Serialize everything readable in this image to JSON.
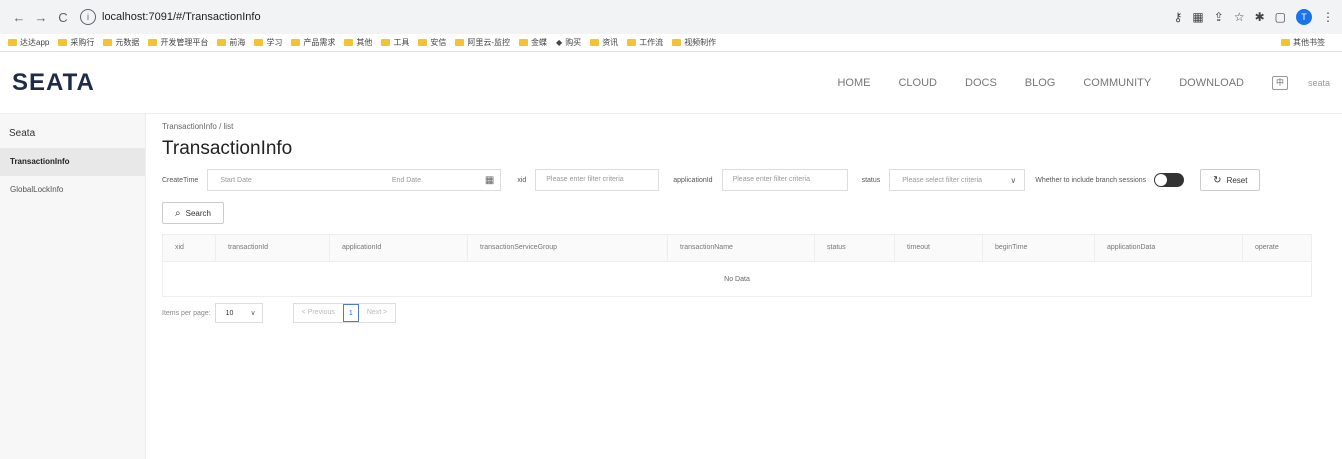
{
  "browser": {
    "url": "localhost:7091/#/TransactionInfo",
    "bookmarks": [
      "达达app",
      "采购行",
      "元数据",
      "开发管理平台",
      "前海",
      "学习",
      "产品需求",
      "其他",
      "工具",
      "安信",
      "阿里云-监控",
      "金蝶",
      "购买",
      "资讯",
      "工作流",
      "视频制作"
    ],
    "other_bookmarks": "其他书签",
    "avatar_letter": "T"
  },
  "header": {
    "logo": "SEATA",
    "nav": [
      "HOME",
      "CLOUD",
      "DOCS",
      "BLOG",
      "COMMUNITY",
      "DOWNLOAD"
    ],
    "lang_label": "中",
    "user": "seata"
  },
  "sidebar": {
    "title": "Seata",
    "items": [
      {
        "label": "TransactionInfo",
        "active": true
      },
      {
        "label": "GlobalLockInfo",
        "active": false
      }
    ]
  },
  "breadcrumb": "TransactionInfo  /  list",
  "page_title": "TransactionInfo",
  "filters": {
    "create_time_label": "CreateTime",
    "start_placeholder": "Start Date",
    "end_placeholder": "End Date",
    "xid_label": "xid",
    "xid_placeholder": "Please enter filter criteria",
    "application_label": "applicationId",
    "application_placeholder": "Please enter filter criteria",
    "status_label": "status",
    "status_placeholder": "Please select filter criteria",
    "branch_label": "Whether to include branch sessions",
    "reset_label": "Reset",
    "search_label": "Search"
  },
  "table": {
    "columns": [
      "xid",
      "transactionId",
      "applicationId",
      "transactionServiceGroup",
      "transactionName",
      "status",
      "timeout",
      "beginTime",
      "applicationData",
      "operate"
    ],
    "empty_text": "No Data"
  },
  "pagination": {
    "items_label": "Items per page:",
    "page_size": "10",
    "prev_label": "< Previous",
    "current_page": "1",
    "next_label": "Next >"
  }
}
